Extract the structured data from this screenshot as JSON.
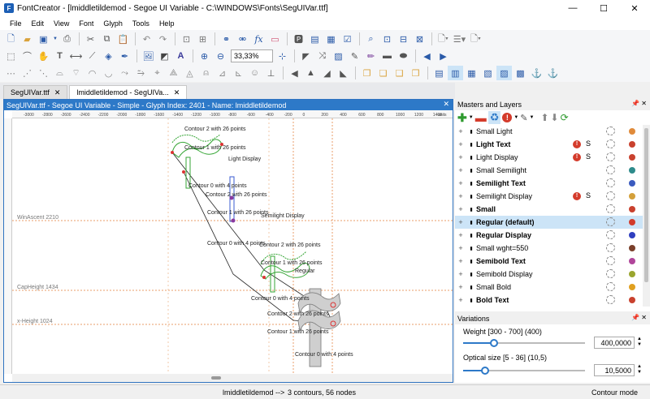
{
  "window": {
    "title": "FontCreator - [lmiddletildemod - Segoe UI Variable - C:\\WINDOWS\\Fonts\\SegUIVar.ttf]",
    "app_icon_letter": "F",
    "minimize": "—",
    "maximize": "☐",
    "close": "✕"
  },
  "menu": [
    "File",
    "Edit",
    "View",
    "Font",
    "Glyph",
    "Tools",
    "Help"
  ],
  "toolbar": {
    "zoom_value": "33,33%"
  },
  "tabs": [
    {
      "label": "SegUIVar.ttf"
    },
    {
      "label": "lmiddletildemod - SegUIVa..."
    }
  ],
  "glyph_window": {
    "title": "SegUIVar.ttf - Segoe UI Variable - Simple - Glyph Index: 2401 - Name: lmiddletildemod",
    "ruler_ticks": [
      "-3000",
      "-2800",
      "-2600",
      "-2400",
      "-2200",
      "-2000",
      "-1800",
      "-1600",
      "-1400",
      "-1200",
      "-1000",
      "-800",
      "-600",
      "-400",
      "-200",
      "0",
      "200",
      "400",
      "600",
      "800",
      "1000",
      "1200",
      "1400"
    ],
    "ruler_units": "units",
    "metrics": {
      "win_ascent": "WinAscent 2210",
      "cap_height": "CapHeight 1434",
      "x_height": "x-Height 1024"
    },
    "labels": {
      "light_display": "Light Display",
      "semilight_display": "Semilight Display",
      "regular": "Regular",
      "c2_top": "Contour 2 with 26 points",
      "c1_top": "Contour 1 with 26 points",
      "c0_top": "Contour 0 with 4 points",
      "c2_mid": "Contour 2 with 26 points",
      "c1_mid": "Contour 1 with 26 points",
      "c0_mid": "Contour 0 with 4 points",
      "c2_reg": "Contour 2 with 26 points",
      "c1_reg": "Contour 1 with 26 points",
      "c0_reg": "Contour 0 with 4 points",
      "c2_bot": "Contour 2 with 26 points",
      "c1_bot": "Contour 1 with 26 points",
      "c0_bot": "Contour 0 with 4 points"
    }
  },
  "masters_panel": {
    "title": "Masters and Layers",
    "pin": "📌 ✕",
    "masters": [
      {
        "name": "Small Light",
        "bold": false,
        "warn": false,
        "color": "#e08a3a",
        "selected": false
      },
      {
        "name": "Light Text",
        "bold": true,
        "warn": true,
        "color": "#c9412e",
        "selected": false
      },
      {
        "name": "Light Display",
        "bold": false,
        "warn": true,
        "color": "#c9412e",
        "selected": false
      },
      {
        "name": "Small Semilight",
        "bold": false,
        "warn": false,
        "color": "#2e8b8b",
        "selected": false
      },
      {
        "name": "Semilight Text",
        "bold": true,
        "warn": false,
        "color": "#3b5bbf",
        "selected": false
      },
      {
        "name": "Semilight Display",
        "bold": false,
        "warn": true,
        "color": "#d4a03a",
        "selected": false
      },
      {
        "name": "Small",
        "bold": true,
        "warn": false,
        "color": "#c9412e",
        "selected": false
      },
      {
        "name": "Regular (default)",
        "bold": true,
        "warn": false,
        "color": "#d23b2b",
        "selected": true
      },
      {
        "name": "Regular Display",
        "bold": true,
        "warn": false,
        "color": "#2f3fbf",
        "selected": false
      },
      {
        "name": "Small wght=550",
        "bold": false,
        "warn": false,
        "color": "#7a3f2a",
        "selected": false
      },
      {
        "name": "Semibold Text",
        "bold": true,
        "warn": false,
        "color": "#b0459a",
        "selected": false
      },
      {
        "name": "Semibold Display",
        "bold": false,
        "warn": false,
        "color": "#9aa52e",
        "selected": false
      },
      {
        "name": "Small Bold",
        "bold": false,
        "warn": false,
        "color": "#e0a020",
        "selected": false
      },
      {
        "name": "Bold Text",
        "bold": true,
        "warn": false,
        "color": "#c9412e",
        "selected": false
      }
    ],
    "s_label": "S"
  },
  "variations_panel": {
    "title": "Variations",
    "weight": {
      "label": "Weight [300 - 700] (400)",
      "value": "400,0000",
      "fraction": 0.25
    },
    "optical": {
      "label": "Optical size [5 - 36] (10,5)",
      "value": "10,5000",
      "fraction": 0.177
    }
  },
  "status": {
    "glyph": "lmiddletildemod -->",
    "info": "3 contours, 56 nodes",
    "mode": "Contour mode"
  }
}
